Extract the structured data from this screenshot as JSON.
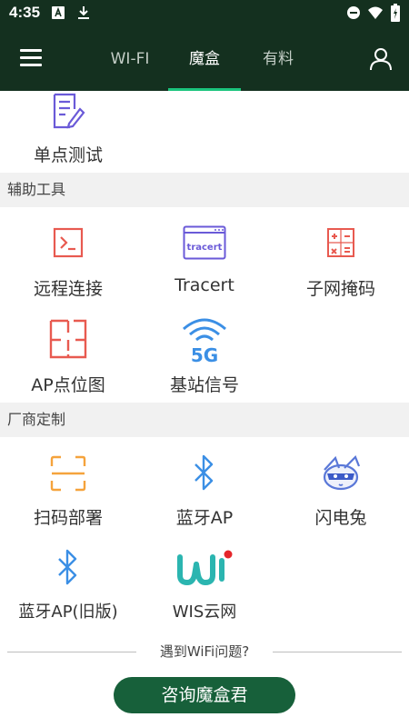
{
  "status_bar": {
    "time": "4:35"
  },
  "app_bar": {
    "tabs": [
      {
        "label": "WI-FI"
      },
      {
        "label": "魔盒"
      },
      {
        "label": "有料"
      }
    ],
    "active_tab": "魔盒"
  },
  "top_item": {
    "label": "单点测试",
    "icon": "document-edit-icon"
  },
  "sections": [
    {
      "title": "辅助工具",
      "items": [
        {
          "label": "远程连接",
          "icon": "terminal-icon"
        },
        {
          "label": "Tracert",
          "icon": "tracert-icon",
          "icon_text": "tracert"
        },
        {
          "label": "子网掩码",
          "icon": "calculator-icon"
        },
        {
          "label": "AP点位图",
          "icon": "floor-plan-icon"
        },
        {
          "label": "基站信号",
          "icon": "5g-signal-icon",
          "icon_text": "5G"
        }
      ]
    },
    {
      "title": "厂商定制",
      "items": [
        {
          "label": "扫码部署",
          "icon": "scan-frame-icon"
        },
        {
          "label": "蓝牙AP",
          "icon": "bluetooth-icon"
        },
        {
          "label": "闪电兔",
          "icon": "lightning-rabbit-icon"
        },
        {
          "label": "蓝牙AP(旧版)",
          "icon": "bluetooth-icon"
        },
        {
          "label": "WIS云网",
          "icon": "wis-logo-icon"
        }
      ]
    }
  ],
  "footer": {
    "question": "遇到WiFi问题?",
    "button_label": "咨询魔盒君"
  },
  "colors": {
    "app_bar": "#14301f",
    "tab_indicator": "#1bc47d",
    "button": "#17603a",
    "icon_red": "#e85a50",
    "icon_purple": "#6a5ad8",
    "icon_blue": "#3b8fe5",
    "icon_orange": "#f5a33c"
  }
}
